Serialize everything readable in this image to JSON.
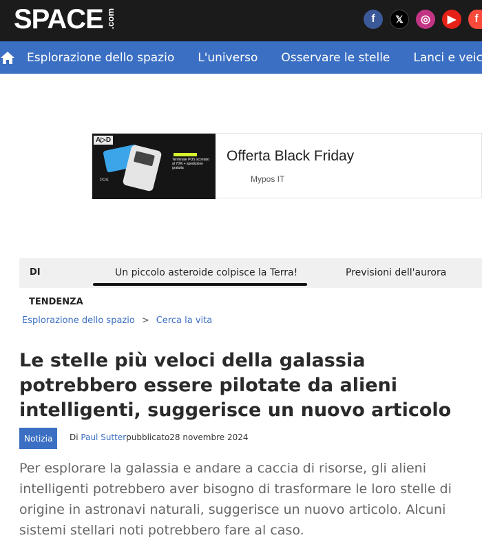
{
  "header": {
    "logo_main": "SPACE",
    "logo_suffix": ".com",
    "socials": [
      {
        "icon": "facebook-icon",
        "glyph": "f",
        "color": "#3b5998"
      },
      {
        "icon": "x-icon",
        "glyph": "𝕏",
        "color": "#000000"
      },
      {
        "icon": "instagram-icon",
        "glyph": "◎",
        "color": "#c13584"
      },
      {
        "icon": "youtube-icon",
        "glyph": "▶",
        "color": "#e62117"
      },
      {
        "icon": "flipboard-icon",
        "glyph": "f",
        "color": "#f74a3b"
      }
    ]
  },
  "nav": {
    "home_icon": "home-icon",
    "items": [
      "Esplorazione dello spazio",
      "L'universo",
      "Osservare le stelle",
      "Lanci e veicoli"
    ]
  },
  "ad": {
    "badge": "A▷D",
    "image_text": "Terminale POS scontato al 70% + spedizione gratuita",
    "image_pos": "POS",
    "title": "Offerta Black Friday",
    "brand": "Mypos IT"
  },
  "trending": {
    "label_top": "DI",
    "label_bottom": "TENDENZA",
    "items": [
      "Un piccolo asteroide colpisce la Terra!",
      "Previsioni dell'aurora"
    ]
  },
  "breadcrumb": {
    "items": [
      "Esplorazione dello spazio",
      "Cerca la vita"
    ],
    "separator": ">"
  },
  "article": {
    "headline": "Le stelle più veloci della galassia potrebbero essere pilotate da alieni intelligenti, suggerisce un nuovo articolo",
    "tag": "Notizia",
    "by_label": "Di",
    "author": "Paul Sutter",
    "published_label": "pubblicato",
    "date": "28 novembre 2024",
    "lede": "Per esplorare la galassia e andare a caccia di risorse, gli alieni intelligenti potrebbero aver bisogno di trasformare le loro stelle di origine in astronavi naturali, suggerisce un nuovo articolo. Alcuni sistemi stellari noti potrebbero fare al caso."
  },
  "colors": {
    "topbar": "#1b1b1b",
    "nav": "#3b6fc3",
    "link": "#3b6fc3"
  }
}
